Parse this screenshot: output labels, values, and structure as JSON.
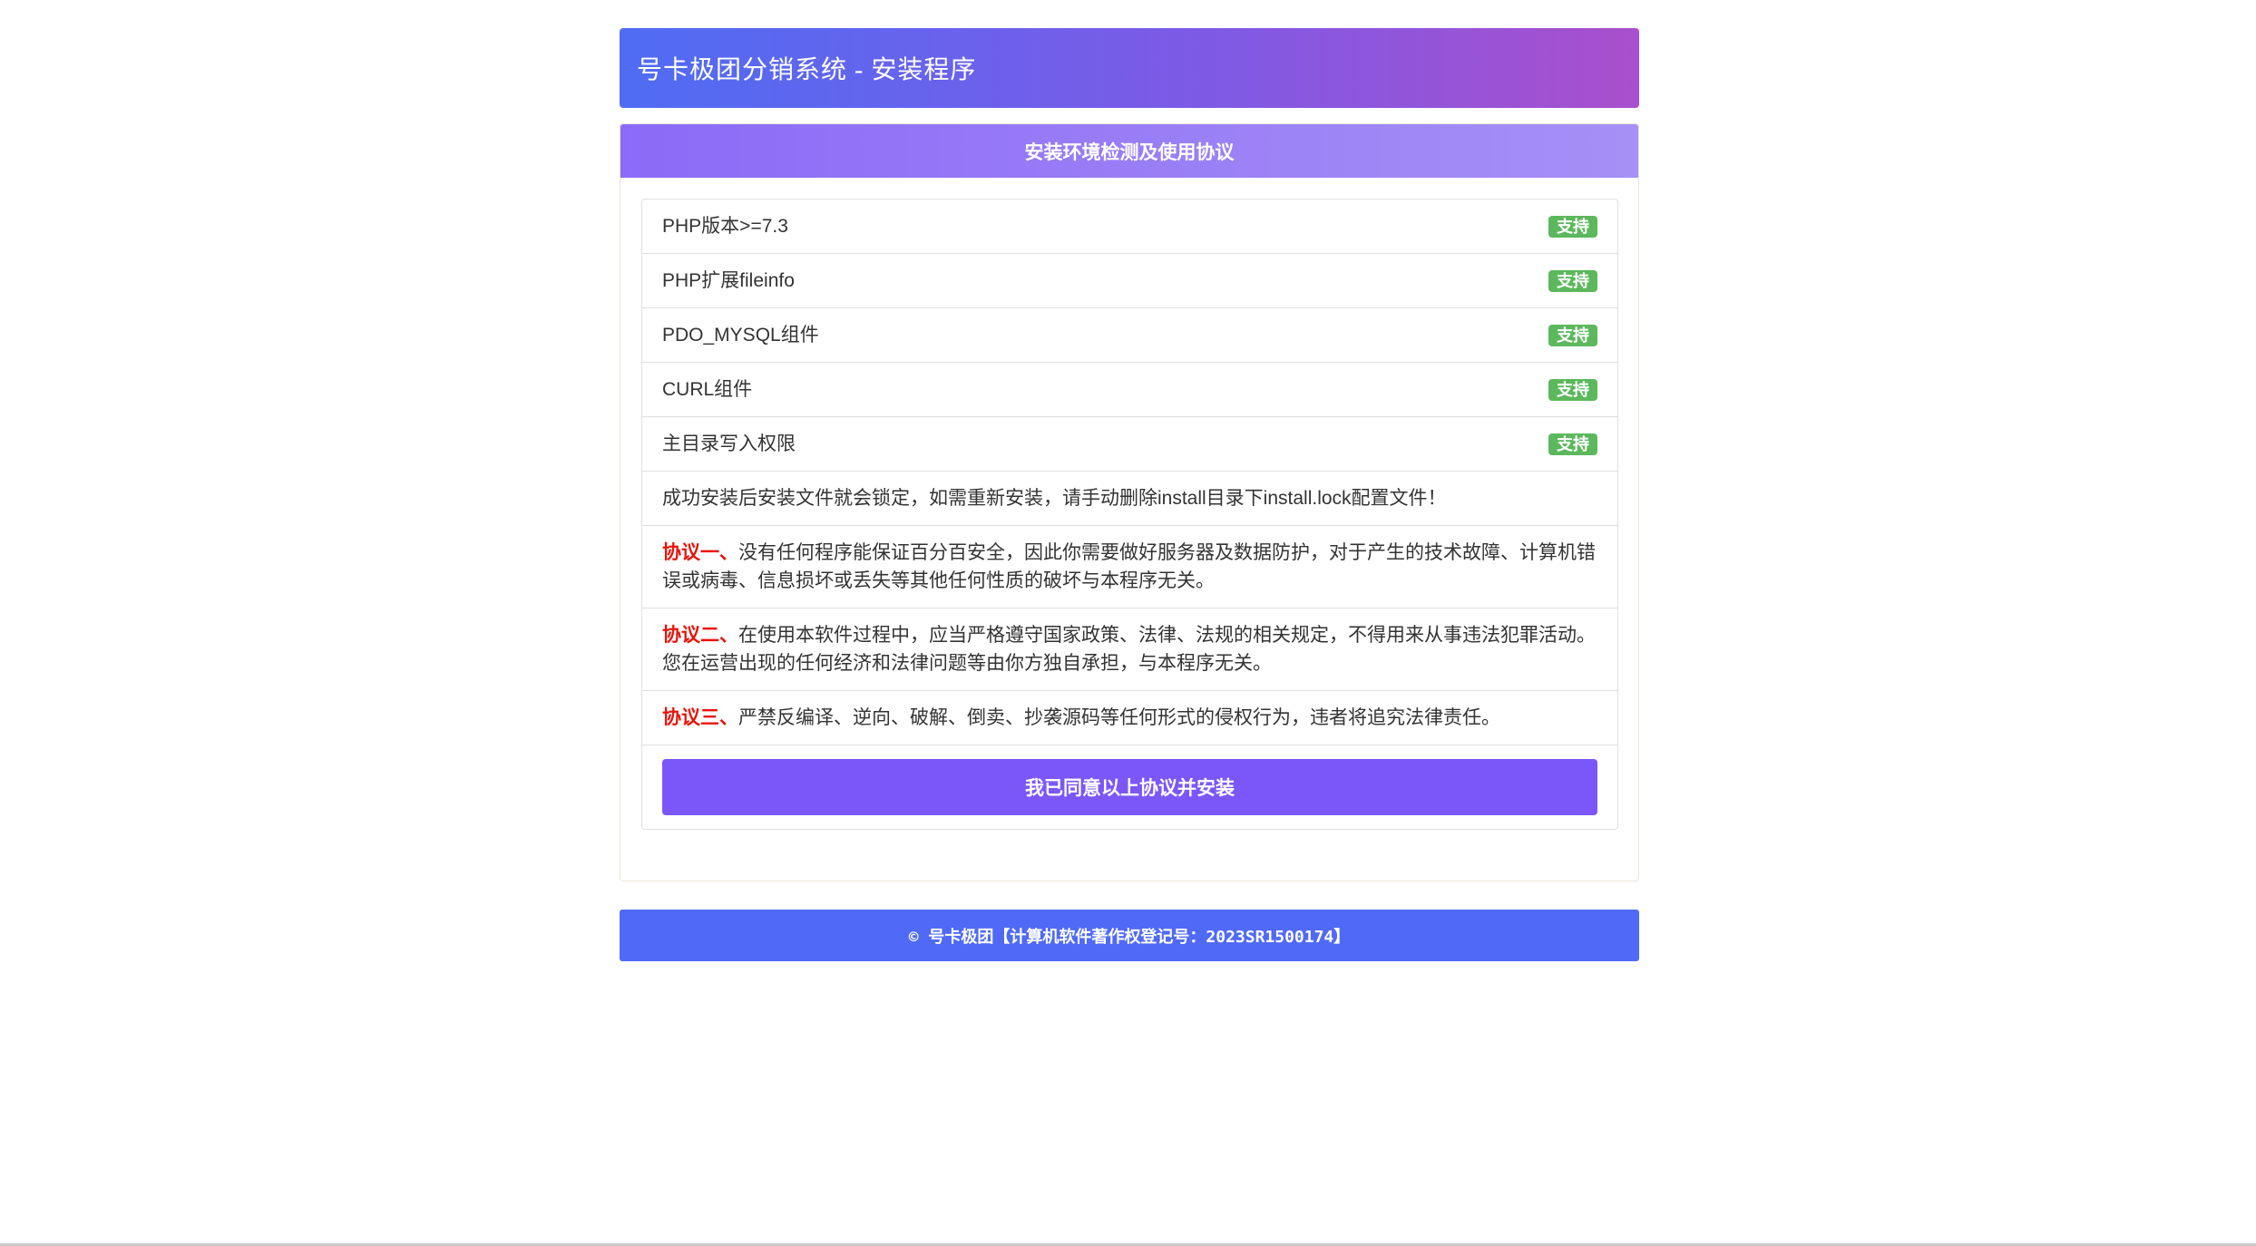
{
  "header": {
    "title": "号卡极团分销系统 - 安装程序"
  },
  "panel": {
    "heading": "安装环境检测及使用协议",
    "checks": [
      {
        "label": "PHP版本>=7.3",
        "status": "支持"
      },
      {
        "label": "PHP扩展fileinfo",
        "status": "支持"
      },
      {
        "label": "PDO_MYSQL组件",
        "status": "支持"
      },
      {
        "label": "CURL组件",
        "status": "支持"
      },
      {
        "label": "主目录写入权限",
        "status": "支持"
      }
    ],
    "notice": "成功安装后安装文件就会锁定，如需重新安装，请手动删除install目录下install.lock配置文件！",
    "agreements": [
      {
        "prefix": "协议一、",
        "text": "没有任何程序能保证百分百安全，因此你需要做好服务器及数据防护，对于产生的技术故障、计算机错误或病毒、信息损坏或丢失等其他任何性质的破坏与本程序无关。"
      },
      {
        "prefix": "协议二、",
        "text": "在使用本软件过程中，应当严格遵守国家政策、法律、法规的相关规定，不得用来从事违法犯罪活动。您在运营出现的任何经济和法律问题等由你方独自承担，与本程序无关。"
      },
      {
        "prefix": "协议三、",
        "text": "严禁反编译、逆向、破解、倒卖、抄袭源码等任何形式的侵权行为，违者将追究法律责任。"
      }
    ],
    "agree_button": "我已同意以上协议并安装"
  },
  "footer": {
    "text": "© 号卡极团【计算机软件著作权登记号：2023SR1500174】"
  },
  "colors": {
    "badge_green": "#5cb85c",
    "agreement_prefix": "#e8140b",
    "button_purple": "#7b57fa",
    "footer_blue": "#506af7"
  }
}
